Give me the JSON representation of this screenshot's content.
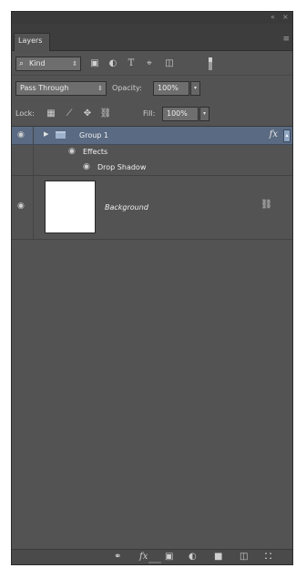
{
  "panel": {
    "title_controls": {
      "collapse": "«",
      "close": "×"
    },
    "tab": {
      "label": "Layers"
    },
    "menu_icon": "panel-menu-icon"
  },
  "filter": {
    "kind_label": "Kind",
    "kind_icon": "search-icon",
    "filter_icons": [
      "pixel-layer-filter-icon",
      "adjustment-layer-filter-icon",
      "type-layer-filter-icon",
      "shape-layer-filter-icon",
      "smart-object-filter-icon"
    ]
  },
  "blend": {
    "mode": "Pass Through",
    "opacity_label": "Opacity:",
    "opacity_value": "100%"
  },
  "lock": {
    "label": "Lock:",
    "lock_icons": [
      "lock-transparent-pixels-icon",
      "lock-image-pixels-icon",
      "lock-position-icon",
      "lock-all-icon"
    ],
    "fill_label": "Fill:",
    "fill_value": "100%"
  },
  "layers": [
    {
      "name": "Group 1",
      "type": "group",
      "selected": true,
      "has_fx": true,
      "fx_label": "fx"
    },
    {
      "name": "Effects",
      "type": "effects-header"
    },
    {
      "name": "Drop Shadow",
      "type": "effect"
    },
    {
      "name": "Background",
      "type": "pixel",
      "locked": true
    }
  ],
  "bottom_toolbar": {
    "buttons": [
      "link-layers-icon",
      "add-layer-style-icon",
      "add-layer-mask-icon",
      "new-fill-adjustment-layer-icon",
      "new-group-icon",
      "new-layer-icon",
      "delete-layer-icon"
    ],
    "fx_label": "fx"
  },
  "colors": {
    "panel_bg": "#535353",
    "selected_row": "#5a6a82",
    "field_bg": "#6e6e6e"
  }
}
